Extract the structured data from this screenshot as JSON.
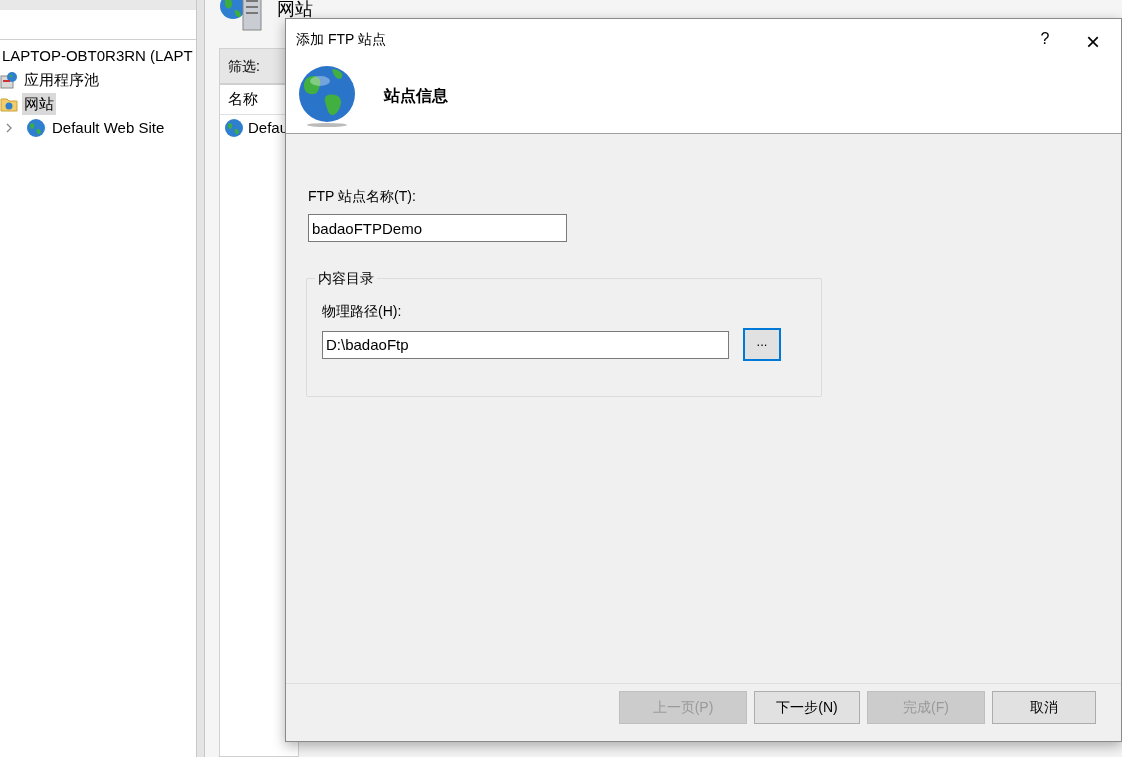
{
  "tree": {
    "items": [
      {
        "label": "LAPTOP-OBT0R3RN (LAPT",
        "kind": "server",
        "selected": false
      },
      {
        "label": "应用程序池",
        "kind": "pool",
        "selected": false
      },
      {
        "label": "网站",
        "kind": "folder",
        "selected": true,
        "children": [
          {
            "label": "Default Web Site",
            "kind": "site",
            "selected": false,
            "expanded": false
          }
        ]
      }
    ]
  },
  "main": {
    "title": "网站",
    "filter_label": "筛选:",
    "column": "名称",
    "rows": [
      "Defau"
    ]
  },
  "dialog": {
    "title": "添加 FTP 站点",
    "help": "?",
    "close": "×",
    "heading": "站点信息",
    "name_label": "FTP 站点名称(T):",
    "name_value": "badaoFTPDemo",
    "group": {
      "legend": "内容目录",
      "path_label": "物理路径(H):",
      "path_value": "D:\\badaoFtp",
      "browse": "..."
    },
    "buttons": [
      {
        "label": "上一页(P)",
        "disabled": true
      },
      {
        "label": "下一步(N)",
        "disabled": false
      },
      {
        "label": "完成(F)",
        "disabled": true
      },
      {
        "label": "取消",
        "disabled": false
      }
    ]
  }
}
